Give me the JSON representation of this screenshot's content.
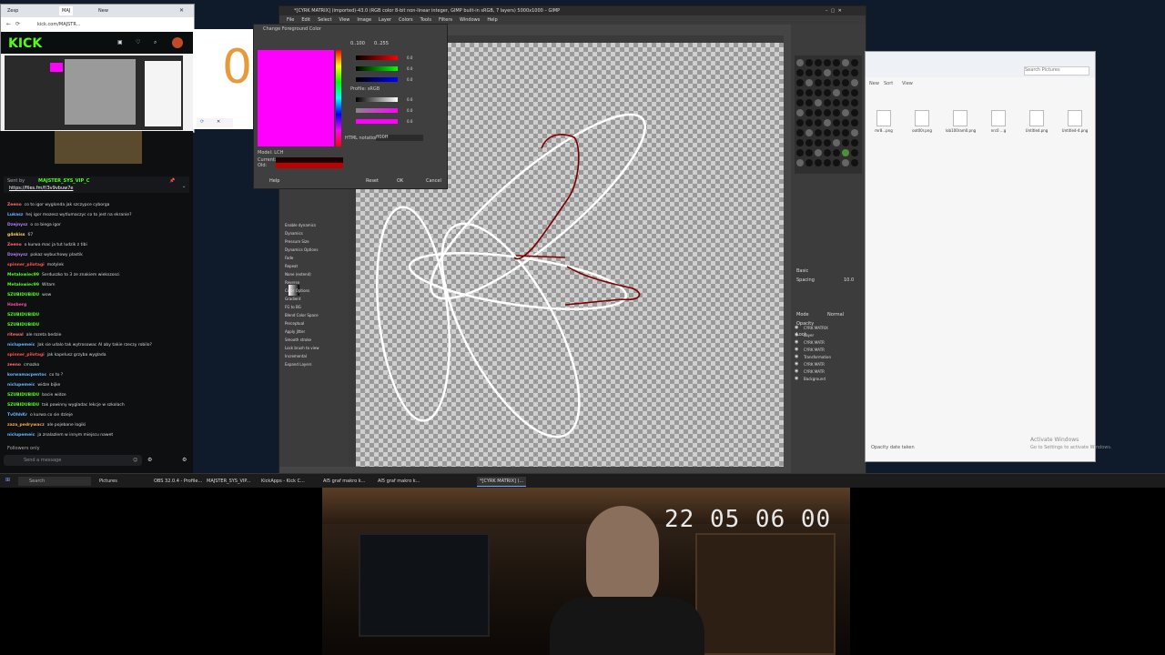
{
  "browser": {
    "tabs": [
      "Zesp",
      "MAJ",
      "New"
    ],
    "url": "kick.com/MAJSTR...",
    "logo": "KICK",
    "send_placeholder": "Send a message",
    "followers_only": "Followers only"
  },
  "chat": {
    "pinned_by": "Sent by",
    "pinned_user": "MAJSTER_SYS_VIP_C",
    "pinned_link": "https://files.fm/f/3v9vbuw7e",
    "messages": [
      {
        "user": "Zeeno",
        "text": "co to igor wyglonda jak szczypce cyborga",
        "color": "#ff6b6b"
      },
      {
        "user": "Lukasz",
        "text": "hej igor mozesz wytlumaczyc co to jest na ekranie?",
        "color": "#6bb6ff"
      },
      {
        "user": "Dzejnysz",
        "text": "o co biega igor",
        "color": "#b77bff"
      },
      {
        "user": "g4nkiss",
        "text": "67",
        "color": "#ffd36b"
      },
      {
        "user": "Zeeno",
        "text": "o kurwa mac ja tut ludzik z tibi",
        "color": "#ff6b6b"
      },
      {
        "user": "Dzejnysz",
        "text": "pokaz wybuchowy plastik",
        "color": "#b77bff"
      },
      {
        "user": "spinner_pilotagi",
        "text": "motylek",
        "color": "#ff5252"
      },
      {
        "user": "Metalowiec99",
        "text": "Serduszko to 3 ze znakiem wiekszosci",
        "color": "#53fc18"
      },
      {
        "user": "Metalowiec99",
        "text": "Witam",
        "color": "#53fc18"
      },
      {
        "user": "SZUBIDUBIDU",
        "text": "wow",
        "color": "#53fc18"
      },
      {
        "user": "Hasberg",
        "text": "",
        "color": "#ff4d9d"
      },
      {
        "user": "SZUBIDUBIDU",
        "text": "",
        "color": "#53fc18"
      },
      {
        "user": "SZUBIDUBIDU",
        "text": "",
        "color": "#53fc18"
      },
      {
        "user": "ritewal",
        "text": "ale rozeta bedzie",
        "color": "#ff6b6b"
      },
      {
        "user": "niclupemeic",
        "text": "Jak sie udalo tak wytrosowac AI aby takie rzeczy robilo?",
        "color": "#6bb6ff"
      },
      {
        "user": "spinner_pilotagi",
        "text": "jak kapelusz grzyba wyglada",
        "color": "#ff5252"
      },
      {
        "user": "zeeno",
        "text": "cmazko",
        "color": "#ff6b6b"
      },
      {
        "user": "korwamacpentoc",
        "text": "co to ?",
        "color": "#6bb6ff"
      },
      {
        "user": "niclupemeic",
        "text": "widze bijke",
        "color": "#6bb6ff"
      },
      {
        "user": "SZUBIDUBIDU",
        "text": "bacie widze",
        "color": "#53fc18"
      },
      {
        "user": "SZUBIDUBIDU",
        "text": "tak powinny wygladac lekcje w szkolach",
        "color": "#53fc18"
      },
      {
        "user": "TvOhhKr",
        "text": "o kurwa co sie dzieje",
        "color": "#6bb6ff"
      },
      {
        "user": "zaza_pedrywacz",
        "text": "ale pojebane logiki",
        "color": "#ffa64d"
      },
      {
        "user": "niclupemeic",
        "text": "ja znalazlem w innym miejscu nawet",
        "color": "#6bb6ff"
      }
    ]
  },
  "gimp": {
    "title": "*[CYRK MATRIX] (imported)-43.0 (RGB color 8-bit non-linear integer, GIMP built-in sRGB, 7 layers) 5000x1000 – GIMP",
    "menu": [
      "File",
      "Edit",
      "Select",
      "View",
      "Image",
      "Layer",
      "Colors",
      "Tools",
      "Filters",
      "Windows",
      "Help"
    ],
    "tool_options": [
      "Enable dynamics",
      "Dynamics",
      "Pressure Size",
      "Dynamics Options",
      "Fade",
      "Repeat",
      "None (extend)",
      "Reverse",
      "Color Options",
      "Gradient",
      "FG to BG",
      "Blend Color Space",
      "Perceptual",
      "Apply Jitter",
      "Smooth stroke",
      "Lock brush to view",
      "Incremental",
      "Expand Layers"
    ],
    "mode_label": "Mode",
    "mode_value": "Normal",
    "opacity_label": "Opacity",
    "lock_label": "Lock",
    "layers": [
      "CYRK MATRIX",
      "Layer",
      "CYRK MATR",
      "CYRK MATR",
      "Transformation",
      "CYRK MATR",
      "CYRK MATR",
      "Background"
    ],
    "basic_label": "Basic",
    "spacing_label": "Spacing",
    "spacing_value": "10.0"
  },
  "color_dialog": {
    "title": "Change Foreground Color",
    "html_notation_label": "HTML notation:",
    "html_notation_value": "ff00ff",
    "model_label": "Model: LCH",
    "current_label": "Current:",
    "old_label": "Old:",
    "profile_label": "Profile: sRGB",
    "values": [
      "0.0",
      "0.0",
      "0.0",
      "0.0",
      "0.0",
      "0.0"
    ],
    "buttons": {
      "help": "Help",
      "reset": "Reset",
      "ok": "OK",
      "cancel": "Cancel"
    },
    "scale_labels": [
      "0..100",
      "0..255"
    ]
  },
  "explorer": {
    "search_placeholder": "Search Pictures",
    "toolbar": [
      "New",
      "Sort",
      "View"
    ],
    "files": [
      "mr8...png",
      "oot00r.png",
      "lob100ram0.png",
      "nrc0 ...g",
      "Untitled.png",
      "Untitled-4.png"
    ],
    "status": "Opacity date taken",
    "activate_title": "Activate Windows",
    "activate_sub": "Go to Settings to activate Windows."
  },
  "taskbar": {
    "search_label": "Search",
    "items": [
      "Pictures",
      "OBS 32.0.4 - Profile...",
      "MAJSTER_SYS_VIP...",
      "Kick&#8203;Apps - Kick C...",
      "AI5 graf makro k...",
      "AI5 graf makro k...",
      "*[CYRK MATRIX] (..."
    ]
  },
  "webcam": {
    "timestamp": "22 05 06 00"
  },
  "colors": {
    "kick_green": "#53fc18",
    "foreground": "#ff00ff",
    "stroke_white": "#ffffff",
    "stroke_red": "#8b0000"
  }
}
